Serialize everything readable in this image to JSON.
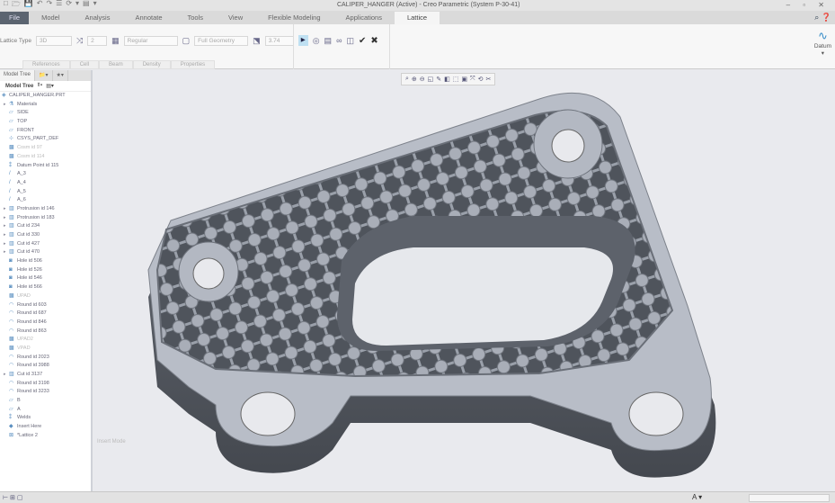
{
  "window": {
    "title": "CALIPER_HANGER (Active) - Creo Parametric (System P-30-41)",
    "quick_access": [
      "□",
      "🗁",
      "💾",
      "↶",
      "↷",
      "☰",
      "⟳",
      "▾",
      "▤",
      "▾"
    ],
    "controls": "– ▫ ✕"
  },
  "tabs": [
    "File",
    "Model",
    "Analysis",
    "Annotate",
    "Tools",
    "View",
    "Flexible Modeling",
    "Applications",
    "Lattice"
  ],
  "active_tab": "Lattice",
  "ribbon": {
    "lattice_type_label": "Lattice Type",
    "lattice_type": "3D",
    "count": "2",
    "cell_type": "Regular",
    "geometry": "Full Geometry",
    "size": "3.74",
    "subtabs": [
      "References",
      "Cell",
      "Beam",
      "Density",
      "Properties"
    ],
    "datum_label": "Datum"
  },
  "tree": {
    "tabs": [
      "Model Tree",
      "",
      "",
      ""
    ],
    "header": "Model Tree",
    "items": [
      {
        "label": "CALIPER_HANGER.PRT",
        "icon": "part",
        "root": true
      },
      {
        "label": "Materials",
        "icon": "materials",
        "expand": true
      },
      {
        "label": "SIDE",
        "icon": "plane"
      },
      {
        "label": "TOP",
        "icon": "plane"
      },
      {
        "label": "FRONT",
        "icon": "plane"
      },
      {
        "label": "CSYS_PART_DEF",
        "icon": "csys"
      },
      {
        "label": "Cosm id 97",
        "icon": "cosm",
        "dim": true
      },
      {
        "label": "Cosm id 114",
        "icon": "cosm",
        "dim": true
      },
      {
        "label": "Datum Point id 115",
        "icon": "point"
      },
      {
        "label": "A_3",
        "icon": "axis"
      },
      {
        "label": "A_4",
        "icon": "axis"
      },
      {
        "label": "A_5",
        "icon": "axis"
      },
      {
        "label": "A_6",
        "icon": "axis"
      },
      {
        "label": "Protrusion id 146",
        "icon": "extrude",
        "expand": true
      },
      {
        "label": "Protrusion id 183",
        "icon": "extrude",
        "expand": true
      },
      {
        "label": "Cut id 234",
        "icon": "extrude",
        "expand": true
      },
      {
        "label": "Cut id 330",
        "icon": "extrude",
        "expand": true
      },
      {
        "label": "Cut id 427",
        "icon": "extrude",
        "expand": true
      },
      {
        "label": "Cut id 470",
        "icon": "extrude",
        "expand": true
      },
      {
        "label": "Hole id 506",
        "icon": "hole"
      },
      {
        "label": "Hole id 526",
        "icon": "hole"
      },
      {
        "label": "Hole id 546",
        "icon": "hole"
      },
      {
        "label": "Hole id 566",
        "icon": "hole"
      },
      {
        "label": "UPAD",
        "icon": "cosm",
        "dim": true
      },
      {
        "label": "Round id 603",
        "icon": "round"
      },
      {
        "label": "Round id 687",
        "icon": "round"
      },
      {
        "label": "Round id 846",
        "icon": "round"
      },
      {
        "label": "Round id 863",
        "icon": "round"
      },
      {
        "label": "UPAD2",
        "icon": "cosm",
        "dim": true
      },
      {
        "label": "VPAD",
        "icon": "cosm",
        "dim": true
      },
      {
        "label": "Round id 2023",
        "icon": "round"
      },
      {
        "label": "Round id 3988",
        "icon": "round"
      },
      {
        "label": "Cut id 3137",
        "icon": "extrude",
        "expand": true
      },
      {
        "label": "Round id 3198",
        "icon": "round"
      },
      {
        "label": "Round id 3233",
        "icon": "round"
      },
      {
        "label": "B",
        "icon": "plane"
      },
      {
        "label": "A",
        "icon": "plane"
      },
      {
        "label": "Welds",
        "icon": "point"
      },
      {
        "label": "Insert Here",
        "icon": "insert"
      },
      {
        "label": "*Lattice 2",
        "icon": "lattice"
      }
    ]
  },
  "viewport": {
    "mode_label": "Insert Mode",
    "toolbar": [
      "⌕",
      "⊕",
      "⊖",
      "◱",
      "✎",
      "◧",
      "⬚",
      "▣",
      "⤧",
      "⟲",
      "✂"
    ]
  },
  "status": {
    "left_icons": "⊢ ⊞ ▢",
    "filter": "A ▾"
  },
  "colors": {
    "accent": "#3a8ec8",
    "file_tab": "#5b6470",
    "part_top": "#b7bcc6",
    "part_side": "#5d626b"
  }
}
